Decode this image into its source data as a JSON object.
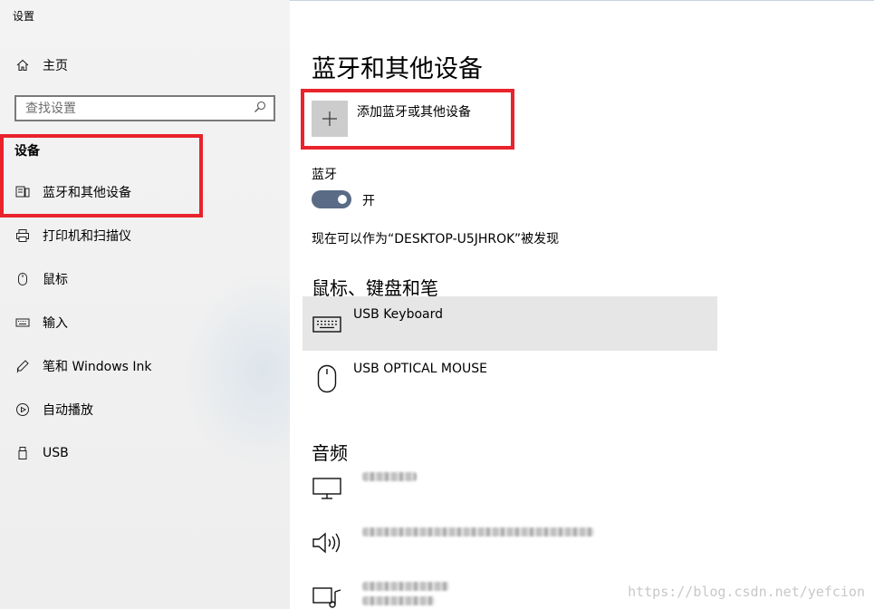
{
  "window": {
    "title": "设置"
  },
  "sidebar": {
    "home_label": "主页",
    "search_placeholder": "查找设置",
    "section_title": "设备",
    "items": [
      {
        "label": "蓝牙和其他设备",
        "icon": "bluetooth-devices-icon",
        "selected": true
      },
      {
        "label": "打印机和扫描仪",
        "icon": "printer-icon"
      },
      {
        "label": "鼠标",
        "icon": "mouse-icon"
      },
      {
        "label": "输入",
        "icon": "keyboard-icon"
      },
      {
        "label": "笔和 Windows Ink",
        "icon": "pen-icon"
      },
      {
        "label": "自动播放",
        "icon": "autoplay-icon"
      },
      {
        "label": "USB",
        "icon": "usb-icon"
      }
    ]
  },
  "main": {
    "title": "蓝牙和其他设备",
    "add_device_label": "添加蓝牙或其他设备",
    "bluetooth_label": "蓝牙",
    "bluetooth_state": "开",
    "bluetooth_on": true,
    "discoverable_text": "现在可以作为“DESKTOP-U5JHROK”被发现",
    "input_group_title": "鼠标、键盘和笔",
    "input_devices": [
      {
        "name": "USB Keyboard",
        "icon": "keyboard-icon",
        "selected": true
      },
      {
        "name": "USB OPTICAL MOUSE",
        "icon": "mouse-icon"
      }
    ],
    "audio_group_title": "音频",
    "audio_devices": [
      {
        "icon": "monitor-icon"
      },
      {
        "icon": "speaker-icon"
      },
      {
        "icon": "media-device-icon"
      }
    ]
  },
  "watermark": "https://blog.csdn.net/yefcion",
  "colors": {
    "highlight": "#e8232b",
    "toggle_on": "#5a6b86",
    "selected_row": "#e6e6e6"
  }
}
